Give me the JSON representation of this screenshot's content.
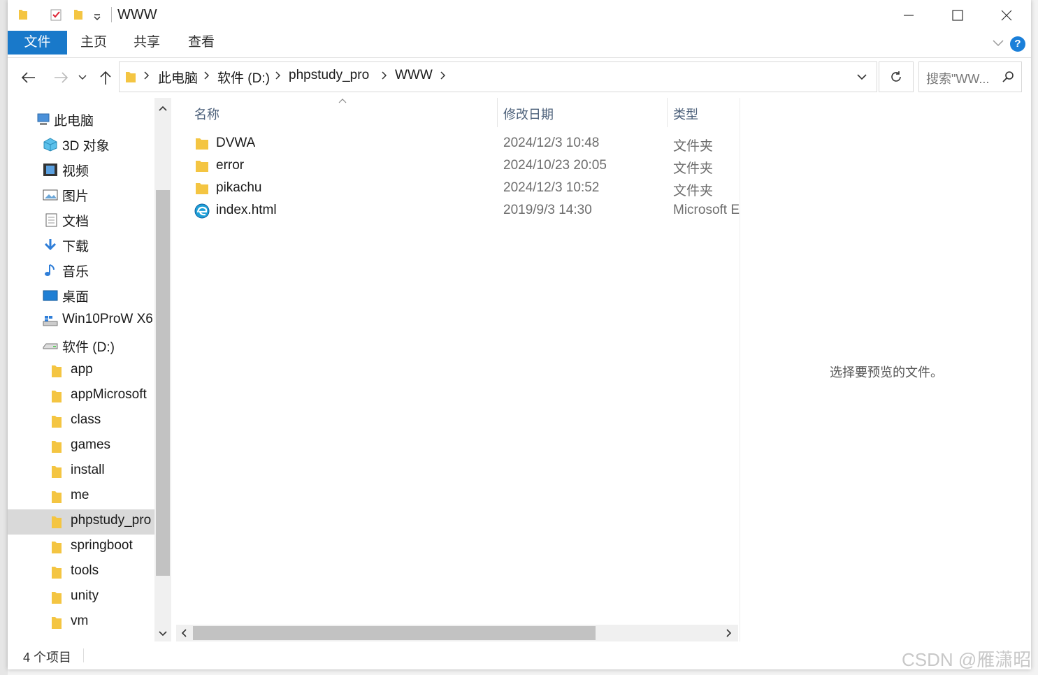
{
  "window": {
    "title": "WWW"
  },
  "ribbon": {
    "tabs": [
      "文件",
      "主页",
      "共享",
      "查看"
    ],
    "help_label": "?"
  },
  "address": {
    "crumbs": [
      "此电脑",
      "软件 (D:)",
      "phpstudy_pro",
      "WWW"
    ]
  },
  "search": {
    "placeholder": "搜索\"WW..."
  },
  "sidebar": {
    "items": [
      {
        "label": "此电脑",
        "icon": "pc-icon"
      },
      {
        "label": "3D 对象",
        "icon": "3d-objects-icon"
      },
      {
        "label": "视频",
        "icon": "video-icon"
      },
      {
        "label": "图片",
        "icon": "pictures-icon"
      },
      {
        "label": "文档",
        "icon": "documents-icon"
      },
      {
        "label": "下载",
        "icon": "download-icon"
      },
      {
        "label": "音乐",
        "icon": "music-icon"
      },
      {
        "label": "桌面",
        "icon": "desktop-icon"
      },
      {
        "label": "Win10ProW X6",
        "icon": "drive-os-icon"
      },
      {
        "label": "软件 (D:)",
        "icon": "drive-icon"
      },
      {
        "label": "app",
        "icon": "folder-icon"
      },
      {
        "label": "appMicrosoft",
        "icon": "folder-icon"
      },
      {
        "label": "class",
        "icon": "folder-icon"
      },
      {
        "label": "games",
        "icon": "folder-icon"
      },
      {
        "label": "install",
        "icon": "folder-icon"
      },
      {
        "label": "me",
        "icon": "folder-icon"
      },
      {
        "label": "phpstudy_pro",
        "icon": "folder-icon"
      },
      {
        "label": "springboot",
        "icon": "folder-icon"
      },
      {
        "label": "tools",
        "icon": "folder-icon"
      },
      {
        "label": "unity",
        "icon": "folder-icon"
      },
      {
        "label": "vm",
        "icon": "folder-icon"
      }
    ],
    "selected": "phpstudy_pro"
  },
  "files": {
    "columns": {
      "name": "名称",
      "date": "修改日期",
      "type": "类型"
    },
    "rows": [
      {
        "name": "DVWA",
        "date": "2024/12/3 10:48",
        "type": "文件夹",
        "icon": "folder-icon"
      },
      {
        "name": "error",
        "date": "2024/10/23 20:05",
        "type": "文件夹",
        "icon": "folder-icon"
      },
      {
        "name": "pikachu",
        "date": "2024/12/3 10:52",
        "type": "文件夹",
        "icon": "folder-icon"
      },
      {
        "name": "index.html",
        "date": "2019/9/3 14:30",
        "type": "Microsoft E",
        "icon": "edge-icon"
      }
    ]
  },
  "preview": {
    "text": "选择要预览的文件。"
  },
  "status": {
    "count": "4 个项目"
  },
  "watermark": "CSDN @雁潇昭",
  "colors": {
    "accent": "#1979ca",
    "folder": "#f4c542",
    "selected": "#d9d9d9"
  }
}
